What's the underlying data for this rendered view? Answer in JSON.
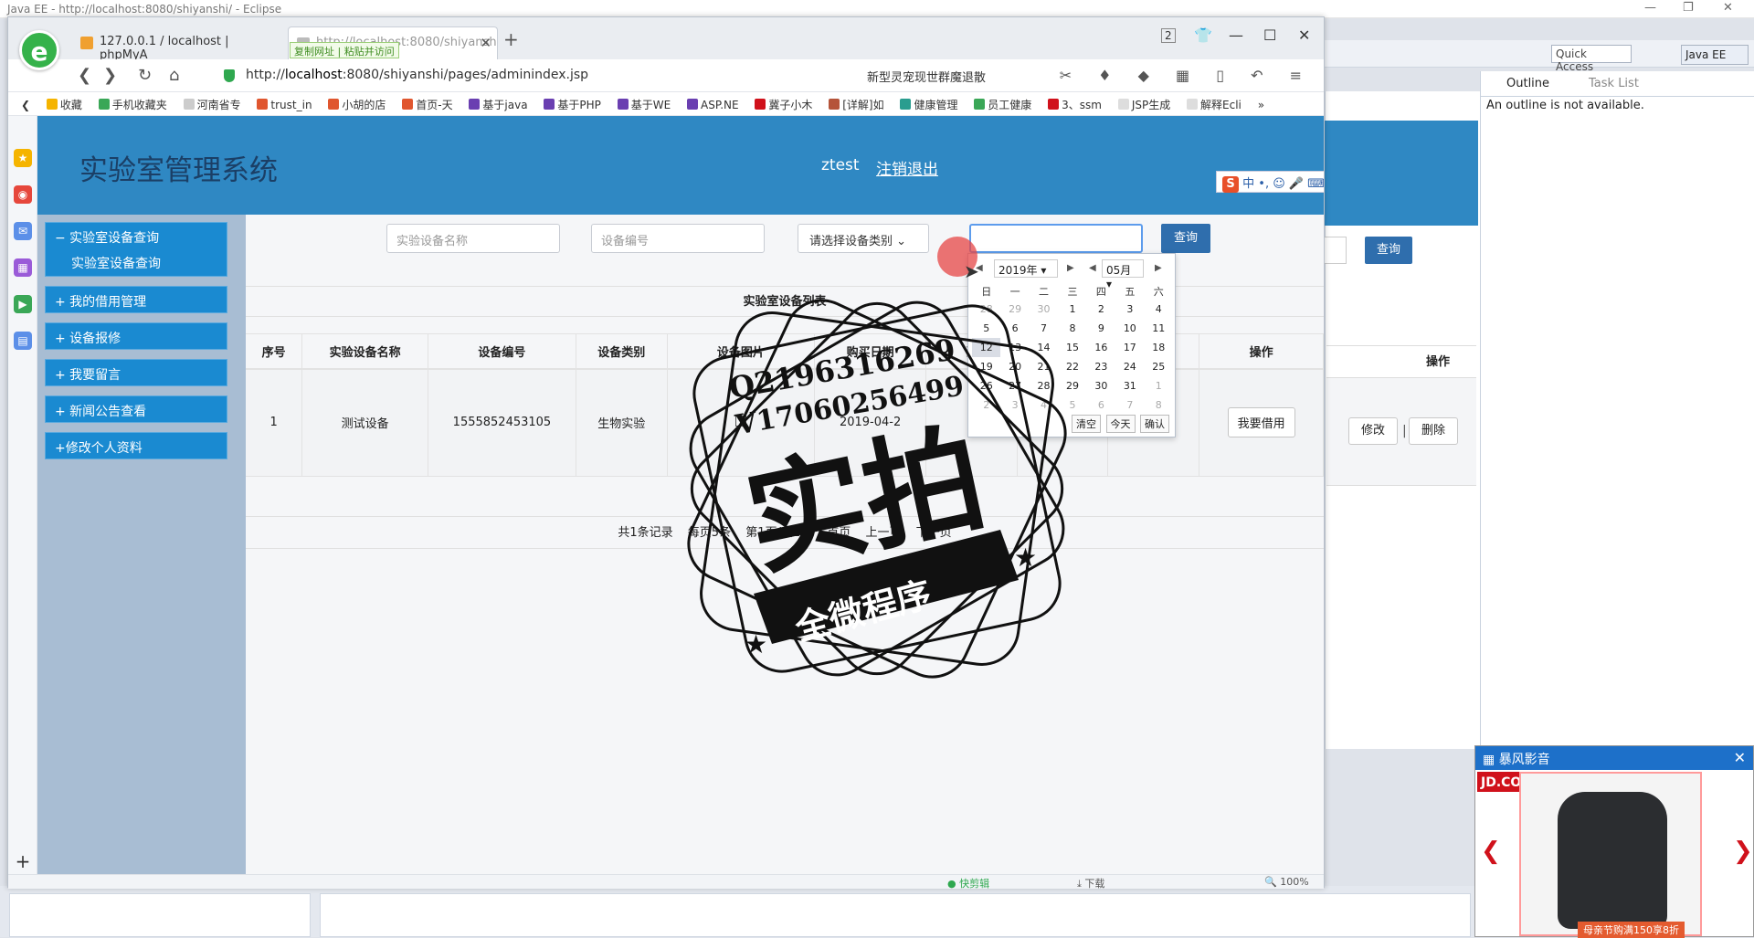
{
  "eclipse": {
    "title": "Java EE - http://localhost:8080/shiyanshi/ - Eclipse",
    "quick_access": "Quick Access",
    "perspective": "Java EE",
    "outline_tab": "Outline",
    "task_list_tab": "Task List",
    "outline_message": "An outline is not available.",
    "bg_query_label": "查询",
    "bg_ops_header": "操作",
    "bg_edit_label": "修改",
    "bg_delete_label": "删除"
  },
  "browser": {
    "tabs": [
      {
        "label": "127.0.0.1 / localhost | phpMyA"
      },
      {
        "label": "http://localhost:8080/shiyansh"
      }
    ],
    "copy_hint": "复制网址 | 粘贴并访问",
    "url_prefix": "http://",
    "url_domain": "localhost",
    "url_rest": ":8080/shiyanshi/pages/adminindex.jsp",
    "news_search": "新型灵宠现世群魔退散",
    "bookmarks": [
      "收藏",
      "手机收藏夹",
      "河南省专",
      "trust_in",
      "小胡的店",
      "首页-天",
      "基于java",
      "基于PHP",
      "基于WE",
      "ASP.NE",
      "冀子小木",
      "[详解]如",
      "健康管理",
      "员工健康",
      "3、ssm",
      "JSP生成",
      "解释Ecli"
    ],
    "status": {
      "kuaijianji": "快剪辑",
      "download": "下载",
      "zoom": "100%"
    }
  },
  "app": {
    "title": "实验室管理系统",
    "username": "ztest",
    "logout": "注销退出",
    "ime_text": "中 •,"
  },
  "sidebar": {
    "items": [
      {
        "label": "− 实验室设备查询"
      },
      {
        "label": "+ 我的借用管理"
      },
      {
        "label": "+ 设备报修"
      },
      {
        "label": "+ 我要留言"
      },
      {
        "label": "+ 新闻公告查看"
      },
      {
        "label": "+修改个人资料"
      }
    ],
    "sub_item": "实验室设备查询"
  },
  "search": {
    "name_placeholder": "实验设备名称",
    "code_placeholder": "设备编号",
    "category_select": "请选择设备类别",
    "query_button": "查询"
  },
  "table": {
    "title": "实验室设备列表",
    "headers": [
      "序号",
      "实验设备名称",
      "设备编号",
      "设备类别",
      "设备图片",
      "购买日期",
      "设",
      "",
      "",
      "操作"
    ],
    "rows": [
      {
        "index": "1",
        "name": "测试设备",
        "code": "1555852453105",
        "category": "生物实验",
        "date": "2019-04-2",
        "action": "我要借用"
      }
    ]
  },
  "pager": {
    "total": "共1条记录",
    "per_page": "每页5条",
    "page_info": "第1页/共1页",
    "first": "首页",
    "prev": "上一页",
    "next": "下一页"
  },
  "datepicker": {
    "year": "2019年",
    "month": "05月",
    "weekdays": [
      "日",
      "一",
      "二",
      "三",
      "四",
      "五",
      "六"
    ],
    "weeks": [
      [
        "28",
        "29",
        "30",
        "1",
        "2",
        "3",
        "4"
      ],
      [
        "5",
        "6",
        "7",
        "8",
        "9",
        "10",
        "11"
      ],
      [
        "12",
        "13",
        "14",
        "15",
        "16",
        "17",
        "18"
      ],
      [
        "19",
        "20",
        "21",
        "22",
        "23",
        "24",
        "25"
      ],
      [
        "26",
        "27",
        "28",
        "29",
        "30",
        "31",
        "1"
      ],
      [
        "2",
        "3",
        "4",
        "5",
        "6",
        "7",
        "8"
      ]
    ],
    "clear": "清空",
    "today": "今天",
    "confirm": "确认"
  },
  "watermark": {
    "qq": "Q2196316269",
    "vx": "V17060256499",
    "big": "实拍",
    "banner": "全微程序"
  },
  "ad": {
    "title": "暴风影音",
    "brand": "JD.COM 京东",
    "promo": "母亲节购满150享8折"
  }
}
